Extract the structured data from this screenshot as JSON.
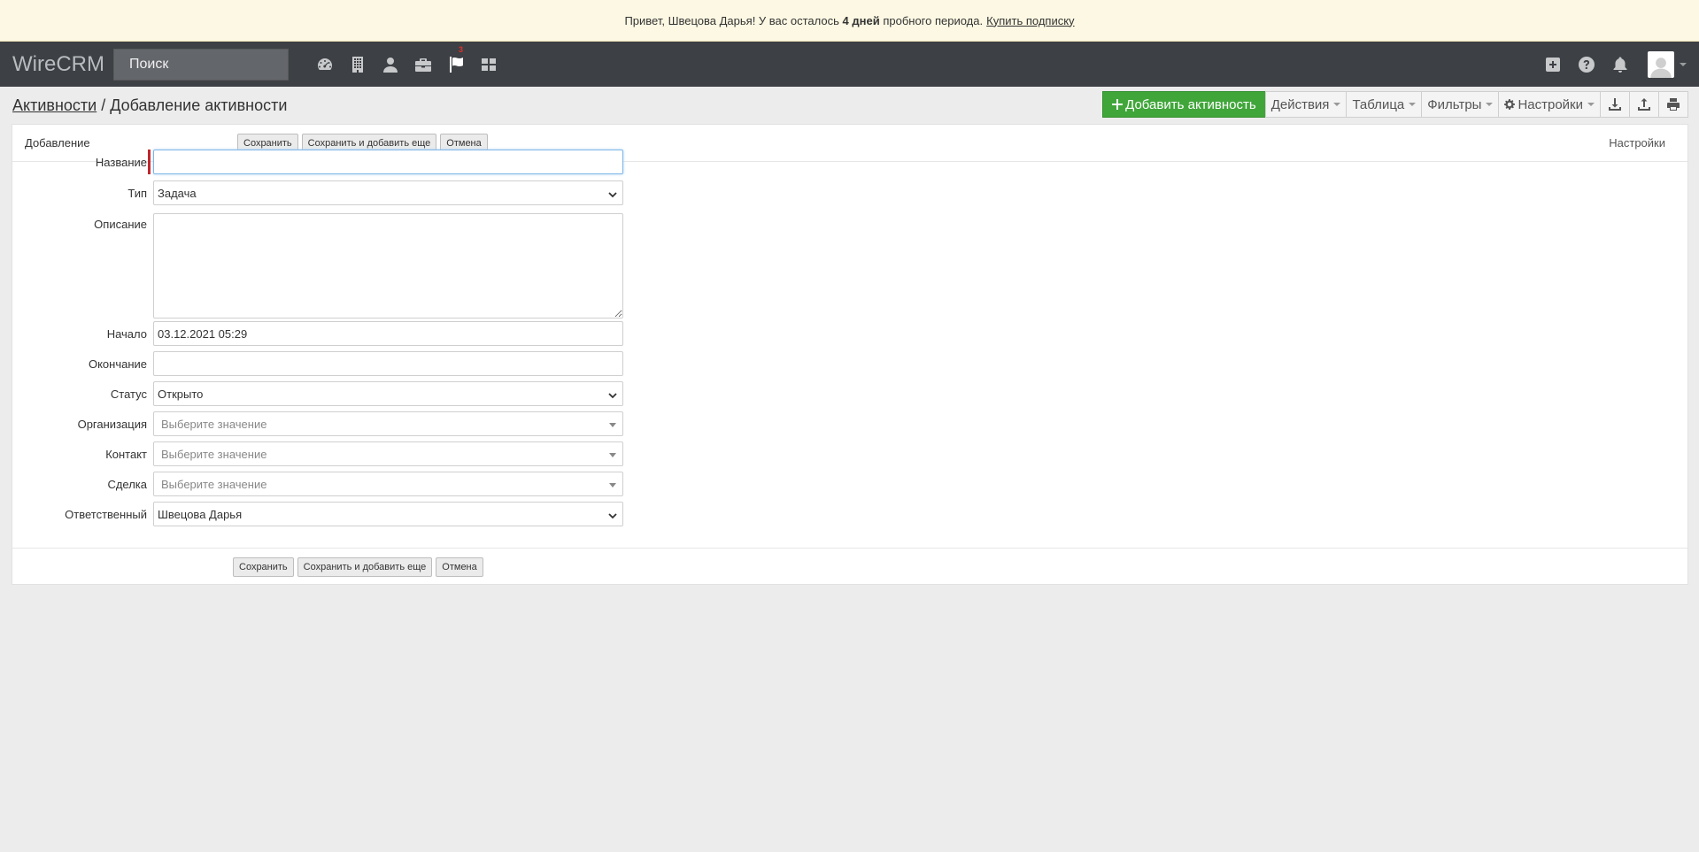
{
  "banner": {
    "text_before": "Привет, Швецова Дарья! У вас осталось",
    "days": "4 дней",
    "text_after": "пробного периода.",
    "link": "Купить подписку"
  },
  "navbar": {
    "brand": "WireCRM",
    "search_placeholder": "Поиск",
    "icons": [
      "dashboard-icon",
      "building-icon",
      "user-icon",
      "briefcase-icon",
      "flag-icon",
      "grid-icon"
    ],
    "flag_badge": "3",
    "right_icons": [
      "plus-square-icon",
      "question-circle-icon",
      "bell-icon",
      "avatar"
    ]
  },
  "page": {
    "breadcrumb_link": "Активности",
    "separator": " / ",
    "title": "Добавление активности"
  },
  "toolbar": {
    "add": "Добавить активность",
    "actions": "Действия",
    "table": "Таблица",
    "filters": "Фильтры",
    "settings": "Настройки"
  },
  "form": {
    "title": "Добавление",
    "settings": "Настройки",
    "save": "Сохранить",
    "save_add": "Сохранить и добавить еще",
    "cancel": "Отмена",
    "fields": {
      "name": {
        "label": "Название",
        "value": ""
      },
      "type": {
        "label": "Тип",
        "value": "Задача"
      },
      "description": {
        "label": "Описание",
        "value": ""
      },
      "start": {
        "label": "Начало",
        "value": "03.12.2021 05:29"
      },
      "end": {
        "label": "Окончание",
        "value": ""
      },
      "status": {
        "label": "Статус",
        "value": "Открыто"
      },
      "organization": {
        "label": "Организация",
        "placeholder": "Выберите значение"
      },
      "contact": {
        "label": "Контакт",
        "placeholder": "Выберите значение"
      },
      "deal": {
        "label": "Сделка",
        "placeholder": "Выберите значение"
      },
      "responsible": {
        "label": "Ответственный",
        "value": "Швецова Дарья"
      }
    }
  },
  "colors": {
    "banner_bg": "#fcf8e3",
    "navbar_bg": "#3d4044",
    "primary_btn": "#40a63a",
    "required": "#c0272d",
    "page_bg": "#ececec"
  }
}
